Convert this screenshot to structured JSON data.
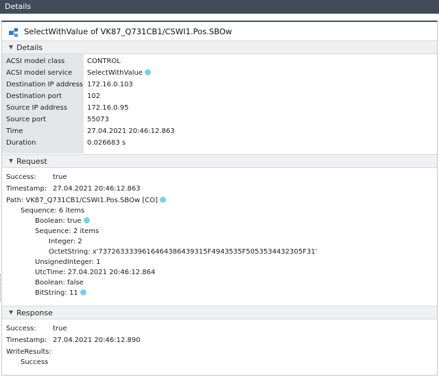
{
  "window": {
    "title": "Details"
  },
  "header": {
    "icon": "message-exchange-icon",
    "title": "SelectWithValue of VK87_Q731CB1/CSWI1.Pos.SBOw"
  },
  "details": {
    "section_title": "Details",
    "rows": [
      {
        "label": "ACSI model class",
        "value": "CONTROL"
      },
      {
        "label": "ACSI model service",
        "value": "SelectWithValue"
      },
      {
        "label": "Destination IP address",
        "value": "172.16.0.103"
      },
      {
        "label": "Destination port",
        "value": "102"
      },
      {
        "label": "Source IP address",
        "value": "172.16.0.95"
      },
      {
        "label": "Source port",
        "value": "55073"
      },
      {
        "label": "Time",
        "value": "27.04.2021 20:46:12.863"
      },
      {
        "label": "Duration",
        "value": "0.026683 s"
      }
    ]
  },
  "request": {
    "section_title": "Request",
    "success_label": "Success:",
    "success_value": "true",
    "timestamp_label": "Timestamp:",
    "timestamp_value": "27.04.2021 20:46:12.863",
    "path": "Path: VK87_Q731CB1/CSWI1.Pos.SBOw [CO]",
    "sequence": "Sequence: 6 items",
    "boolean1": "Boolean: true",
    "sequence2": "Sequence: 2 items",
    "integer": "Integer: 2",
    "octet": "OctetString: x'7372633339616464386439315F4943535F5053534432305F31'",
    "unsigned": "UnsignedInteger: 1",
    "utctime": "UtcTime: 27.04.2021 20:46:12.864",
    "boolean2": "Boolean: false",
    "bitstring": "BitString: 11"
  },
  "response": {
    "section_title": "Response",
    "success_label": "Success:",
    "success_value": "true",
    "timestamp_label": "Timestamp:",
    "timestamp_value": "27.04.2021 20:46:12.890",
    "writeresults": "WriteResults:",
    "result": "Success"
  },
  "colors": {
    "titlebar": "#414b5a",
    "marker": "#7ecdf0",
    "label_column": "#e3e5e8",
    "section_bar": "#eff0f1"
  }
}
